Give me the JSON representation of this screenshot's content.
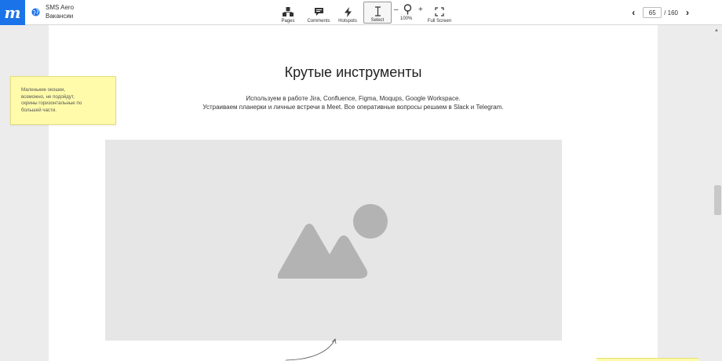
{
  "app": {
    "logo": "m",
    "project_name": "SMS Aero",
    "page_name": "Вакансии"
  },
  "toolbar": {
    "tools": [
      {
        "label": "Pages",
        "icon": "pages-icon"
      },
      {
        "label": "Comments",
        "icon": "comment-icon"
      },
      {
        "label": "Hotspots",
        "icon": "lightning-icon"
      },
      {
        "label": "Select",
        "icon": "text-cursor-icon",
        "active": true
      },
      {
        "label": "Full Screen",
        "icon": "fullscreen-icon"
      }
    ],
    "zoom": {
      "minus": "–",
      "plus": "+",
      "value": "100%"
    }
  },
  "pager": {
    "current": "65",
    "total": "/ 160",
    "prev": "‹",
    "next": "›"
  },
  "content": {
    "heading": "Крутые инструменты",
    "desc_line1": "Используем в работе Jira, Confluence, Figma, Moqups, Google Workspace.",
    "desc_line2": "Устраиваем планерки и личные встречи в Meet. Все оперативные вопросы решаем в Slack и Telegram."
  },
  "sticky_note": {
    "lines": [
      "Маленькие окошки,",
      "возможно, не подойдут,",
      "скрины горизонтальные по",
      "большей части."
    ]
  },
  "colors": {
    "accent": "#1a73e8",
    "sticky": "#fffbaa",
    "placeholder": "#e6e6e6",
    "placeholder_icon": "#b3b3b3"
  }
}
